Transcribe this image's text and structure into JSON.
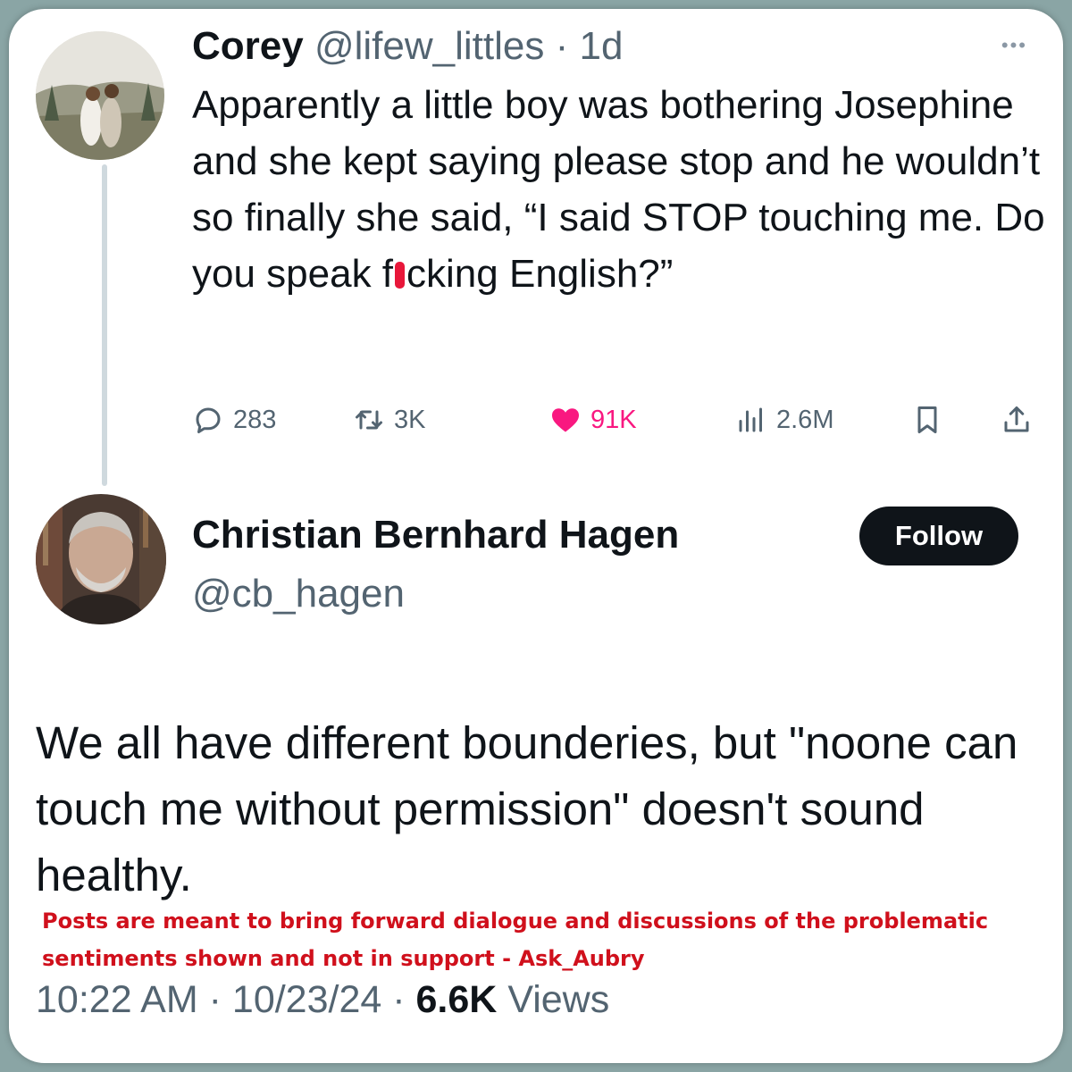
{
  "tweet_main": {
    "author_name": "Corey",
    "author_handle": "@lifew_littles",
    "separator": " · ",
    "time_ago": "1d",
    "text_before": "Apparently a little boy was bothering Josephine and she kept saying please stop and he wouldn’t so finally she said, “I said STOP touching me. Do you speak f",
    "text_after": "cking English?”",
    "stats": {
      "replies": "283",
      "reposts": "3K",
      "likes": "91K",
      "views": "2.6M"
    }
  },
  "tweet_reply": {
    "author_name": "Christian Bernhard Hagen",
    "author_handle": "@cb_hagen",
    "follow_label": "Follow",
    "text": "We all have different bounderies, but \"noone can touch me without permission\" doesn't sound healthy.",
    "time": "10:22 AM",
    "separator": " · ",
    "date": "10/23/24",
    "views_count": "6.6K",
    "views_label": "Views"
  },
  "disclaimer": "Posts are meant to bring forward dialogue and discussions of the problematic sentiments shown and not in support - Ask_Aubry",
  "colors": {
    "background": "#8aa5a5",
    "card": "#ffffff",
    "text_primary": "#0f1419",
    "text_secondary": "#536471",
    "like_accent": "#f91880",
    "disclaimer_red": "#d0101c",
    "follow_button": "#0f1419"
  },
  "icons": [
    "reply-icon",
    "repost-icon",
    "like-icon",
    "views-icon",
    "bookmark-icon",
    "share-icon",
    "more-icon"
  ]
}
